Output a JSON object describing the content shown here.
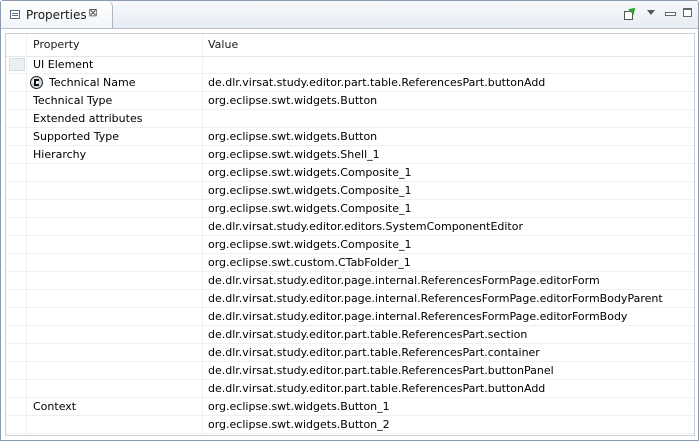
{
  "view": {
    "tab_title": "Properties",
    "tab_close_glyph": "⊠",
    "icons": {
      "tab": "properties-view-icon",
      "close": "close-icon",
      "pin": "pin-icon",
      "menu": "view-menu-icon",
      "minimize": "minimize-icon",
      "maximize": "maximize-icon"
    }
  },
  "table": {
    "columns": [
      "Property",
      "Value"
    ],
    "rows": [
      {
        "property": "UI Element",
        "value": "",
        "indent": false,
        "marker": true
      },
      {
        "property": "Technical Name",
        "value": "de.dlr.virsat.study.editor.part.table.ReferencesPart.buttonAdd",
        "indent": true,
        "icon": "globe-icon"
      },
      {
        "property": "Technical Type",
        "value": "org.eclipse.swt.widgets.Button",
        "indent": false
      },
      {
        "property": "Extended attributes",
        "value": "",
        "indent": false
      },
      {
        "property": "Supported Type",
        "value": "org.eclipse.swt.widgets.Button",
        "indent": false
      },
      {
        "property": "Hierarchy",
        "value": "org.eclipse.swt.widgets.Shell_1",
        "indent": false
      },
      {
        "property": "",
        "value": "org.eclipse.swt.widgets.Composite_1",
        "indent": false
      },
      {
        "property": "",
        "value": "org.eclipse.swt.widgets.Composite_1",
        "indent": false
      },
      {
        "property": "",
        "value": "org.eclipse.swt.widgets.Composite_1",
        "indent": false
      },
      {
        "property": "",
        "value": "de.dlr.virsat.study.editor.editors.SystemComponentEditor",
        "indent": false
      },
      {
        "property": "",
        "value": "org.eclipse.swt.widgets.Composite_1",
        "indent": false
      },
      {
        "property": "",
        "value": "org.eclipse.swt.custom.CTabFolder_1",
        "indent": false
      },
      {
        "property": "",
        "value": "de.dlr.virsat.study.editor.page.internal.ReferencesFormPage.editorForm",
        "indent": false
      },
      {
        "property": "",
        "value": "de.dlr.virsat.study.editor.page.internal.ReferencesFormPage.editorFormBodyParent",
        "indent": false
      },
      {
        "property": "",
        "value": "de.dlr.virsat.study.editor.page.internal.ReferencesFormPage.editorFormBody",
        "indent": false
      },
      {
        "property": "",
        "value": "de.dlr.virsat.study.editor.part.table.ReferencesPart.section",
        "indent": false
      },
      {
        "property": "",
        "value": "de.dlr.virsat.study.editor.part.table.ReferencesPart.container",
        "indent": false
      },
      {
        "property": "",
        "value": "de.dlr.virsat.study.editor.part.table.ReferencesPart.buttonPanel",
        "indent": false
      },
      {
        "property": "",
        "value": "de.dlr.virsat.study.editor.part.table.ReferencesPart.buttonAdd",
        "indent": false
      },
      {
        "property": "Context",
        "value": "org.eclipse.swt.widgets.Button_1",
        "indent": false
      },
      {
        "property": "",
        "value": "org.eclipse.swt.widgets.Button_2",
        "indent": false
      }
    ]
  }
}
